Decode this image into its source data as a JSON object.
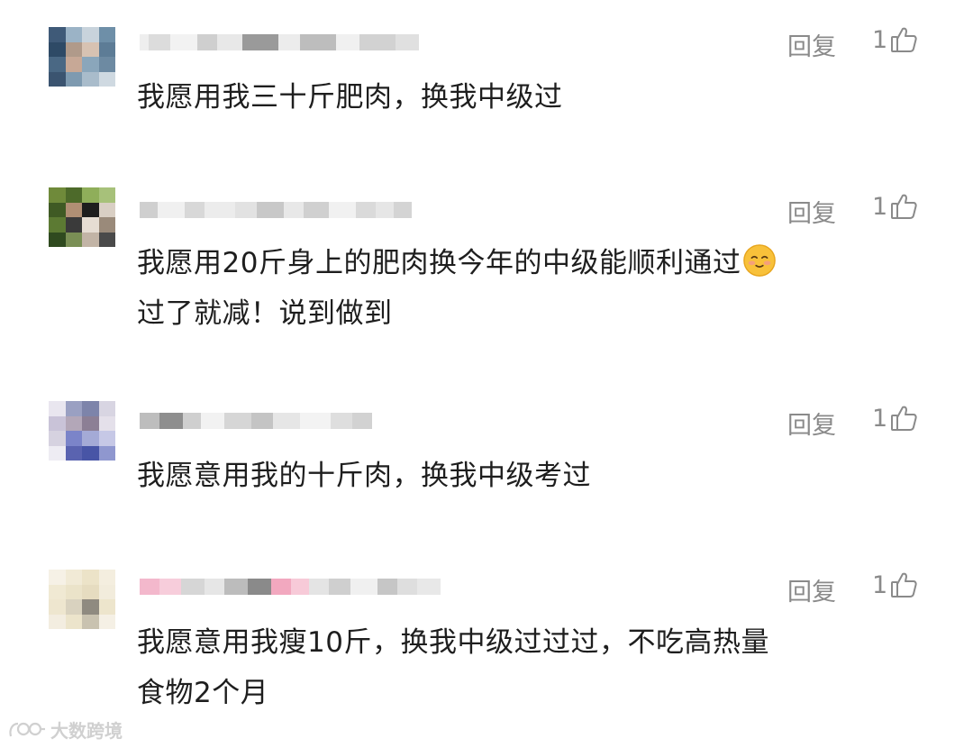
{
  "comments": [
    {
      "reply_label": "回复",
      "likes": "1",
      "text_lines": [
        "我愿用我三十斤肥肉，换我中级过"
      ]
    },
    {
      "reply_label": "回复",
      "likes": "1",
      "text_lines": [
        "我愿用20斤身上的肥肉换今年的中级能顺利通过",
        "过了就减！说到做到"
      ],
      "emoji": "smiling-face-emoji"
    },
    {
      "reply_label": "回复",
      "likes": "1",
      "text_lines": [
        "我愿意用我的十斤肉，换我中级考过"
      ]
    },
    {
      "reply_label": "回复",
      "likes": "1",
      "text_lines": [
        "我愿意用我瘦10斤，换我中级过过过，不吃高热量",
        "食物2个月"
      ]
    }
  ],
  "watermark": {
    "text": "大数跨境"
  },
  "icons": {
    "like": "thumbs-up-icon",
    "watermark_logo": "logo-icon"
  },
  "colors": {
    "meta_gray": "#8a8a8a",
    "text": "#1e1e1e",
    "watermark": "#d0d0d0"
  }
}
